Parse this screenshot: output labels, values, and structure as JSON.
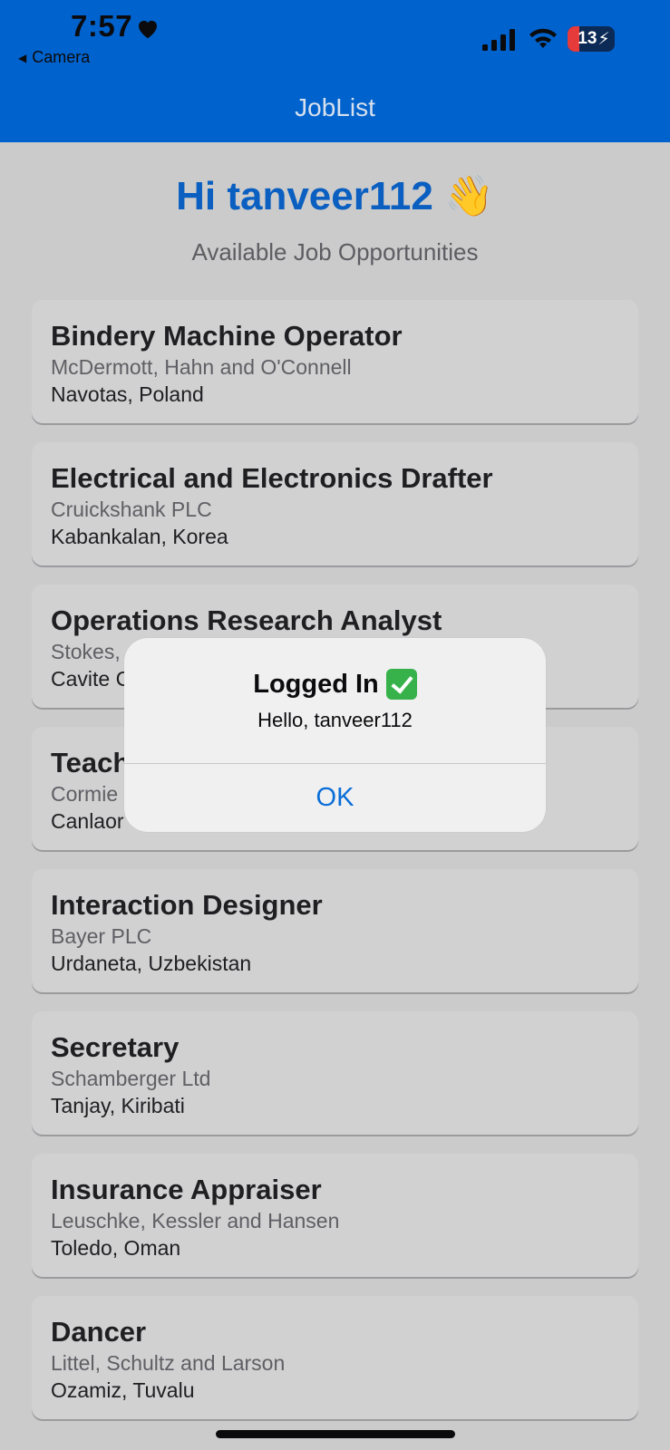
{
  "status_bar": {
    "time": "7:57",
    "back_label": "Camera",
    "battery": "13"
  },
  "header": {
    "title": "JobList"
  },
  "greeting": {
    "text": "Hi tanveer112 👋",
    "subtitle": "Available Job Opportunities"
  },
  "jobs": [
    {
      "title": "Bindery Machine Operator",
      "company": "McDermott, Hahn and O'Connell",
      "location": "Navotas, Poland"
    },
    {
      "title": "Electrical and Electronics Drafter",
      "company": "Cruickshank PLC",
      "location": "Kabankalan, Korea"
    },
    {
      "title": "Operations Research Analyst",
      "company": "Stokes,",
      "location": "Cavite C"
    },
    {
      "title": "Teach",
      "company": "Cormie",
      "location": "Canlaor"
    },
    {
      "title": "Interaction Designer",
      "company": "Bayer PLC",
      "location": "Urdaneta, Uzbekistan"
    },
    {
      "title": "Secretary",
      "company": "Schamberger Ltd",
      "location": "Tanjay, Kiribati"
    },
    {
      "title": "Insurance Appraiser",
      "company": "Leuschke, Kessler and Hansen",
      "location": "Toledo, Oman"
    },
    {
      "title": "Dancer",
      "company": "Littel, Schultz and Larson",
      "location": "Ozamiz, Tuvalu"
    }
  ],
  "alert": {
    "title": "Logged In",
    "message": "Hello, tanveer112",
    "ok_label": "OK"
  },
  "colors": {
    "header_bg": "#0062cc",
    "greeting": "#0a5fc0",
    "alert_button": "#0a6ed8"
  }
}
